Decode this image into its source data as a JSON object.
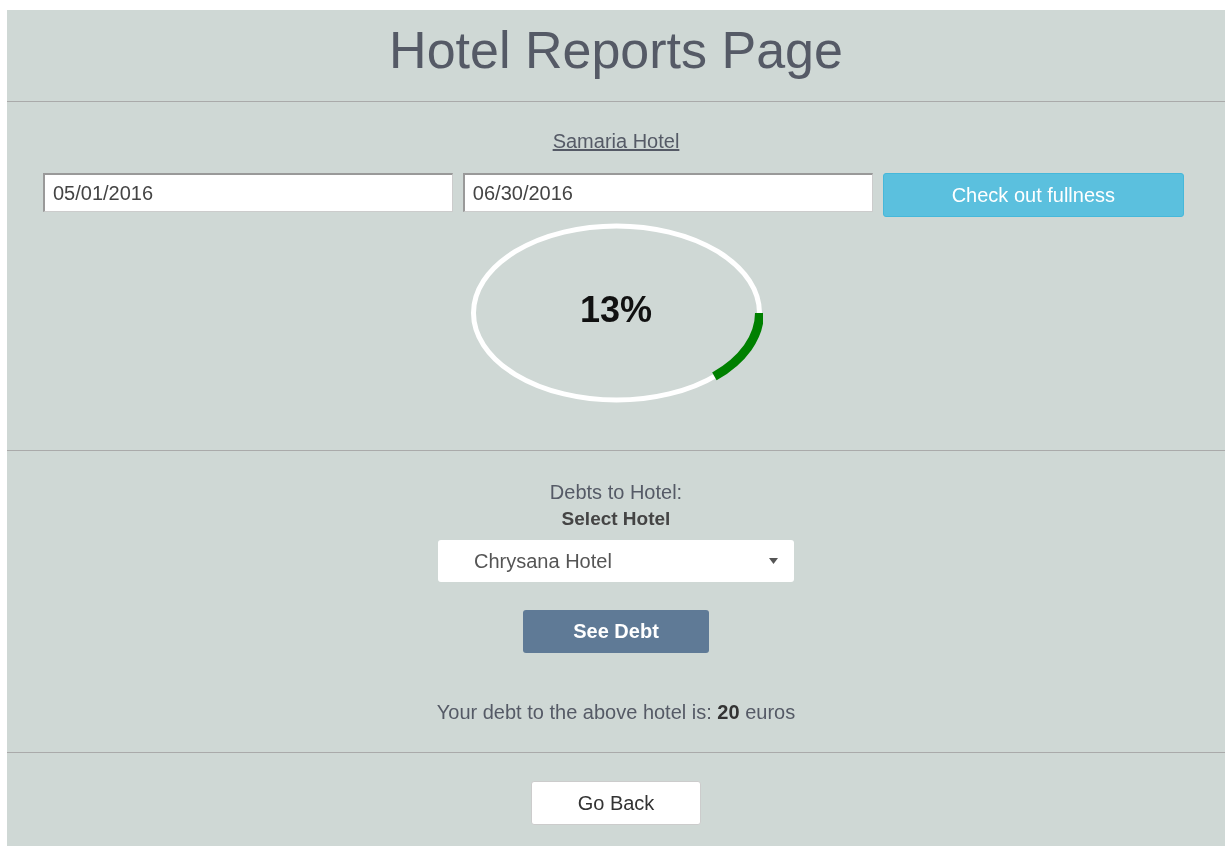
{
  "title": "Hotel Reports Page",
  "hotel_link": "Samaria Hotel ",
  "date_from": {
    "value": "05/01/2016"
  },
  "date_to": {
    "value": "06/30/2016"
  },
  "check_button": "Check out fullness",
  "occupancy": {
    "level": 0.13,
    "reading": "13%"
  },
  "debts_label": "Debts to Hotel:",
  "select_label": "Select Hotel",
  "hotel_select": {
    "value": "Chrysana Hotel"
  },
  "see_debt_button": "See Debt",
  "debt_message": "Your debt to the above hotel is: **20** euros",
  "back_button": "Go Back"
}
